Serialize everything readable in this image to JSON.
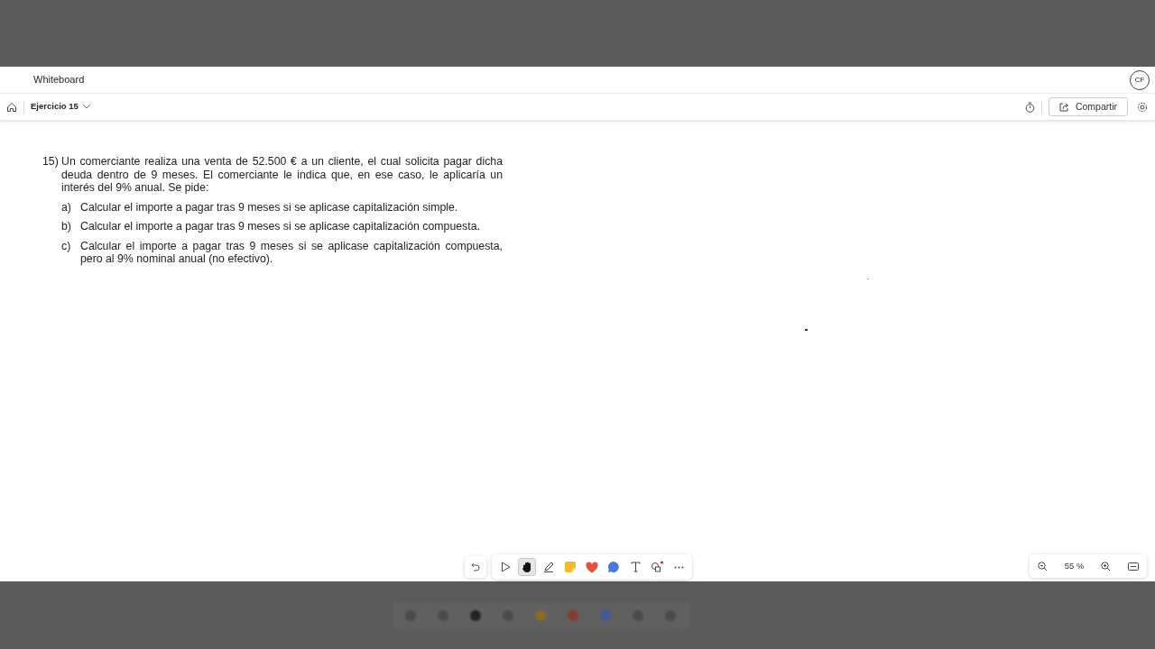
{
  "app": {
    "title": "Whiteboard",
    "avatar": "CF"
  },
  "toolbar": {
    "board_name": "Ejercicio 15",
    "share_button": "Compartir"
  },
  "exercise": {
    "number": "15)",
    "statement": "Un comerciante realiza una venta de 52.500 € a un cliente, el cual solicita pagar dicha deuda dentro de 9 meses. El comerciante le indica que, en ese caso, le aplicaría un interés del 9% anual. Se pide:",
    "items": [
      {
        "letter": "a)",
        "text": "Calcular el importe a pagar tras 9 meses si se aplicase capitalización simple."
      },
      {
        "letter": "b)",
        "text": "Calcular el importe a pagar tras 9 meses si se aplicase capitalización compuesta."
      },
      {
        "letter": "c)",
        "text": "Calcular el importe a pagar tras 9 meses si se aplicase capitalización compuesta, pero al 9% nominal anual (no efectivo)."
      }
    ]
  },
  "tools": [
    {
      "kind": "select",
      "selected": false
    },
    {
      "kind": "hand",
      "selected": true
    },
    {
      "kind": "pen",
      "selected": false
    },
    {
      "kind": "note",
      "selected": false
    },
    {
      "kind": "reaction",
      "selected": false
    },
    {
      "kind": "comment",
      "selected": false
    },
    {
      "kind": "text",
      "selected": false
    },
    {
      "kind": "shapes",
      "selected": false
    },
    {
      "kind": "more",
      "selected": false
    }
  ],
  "zoom": {
    "reading": "55 %"
  }
}
